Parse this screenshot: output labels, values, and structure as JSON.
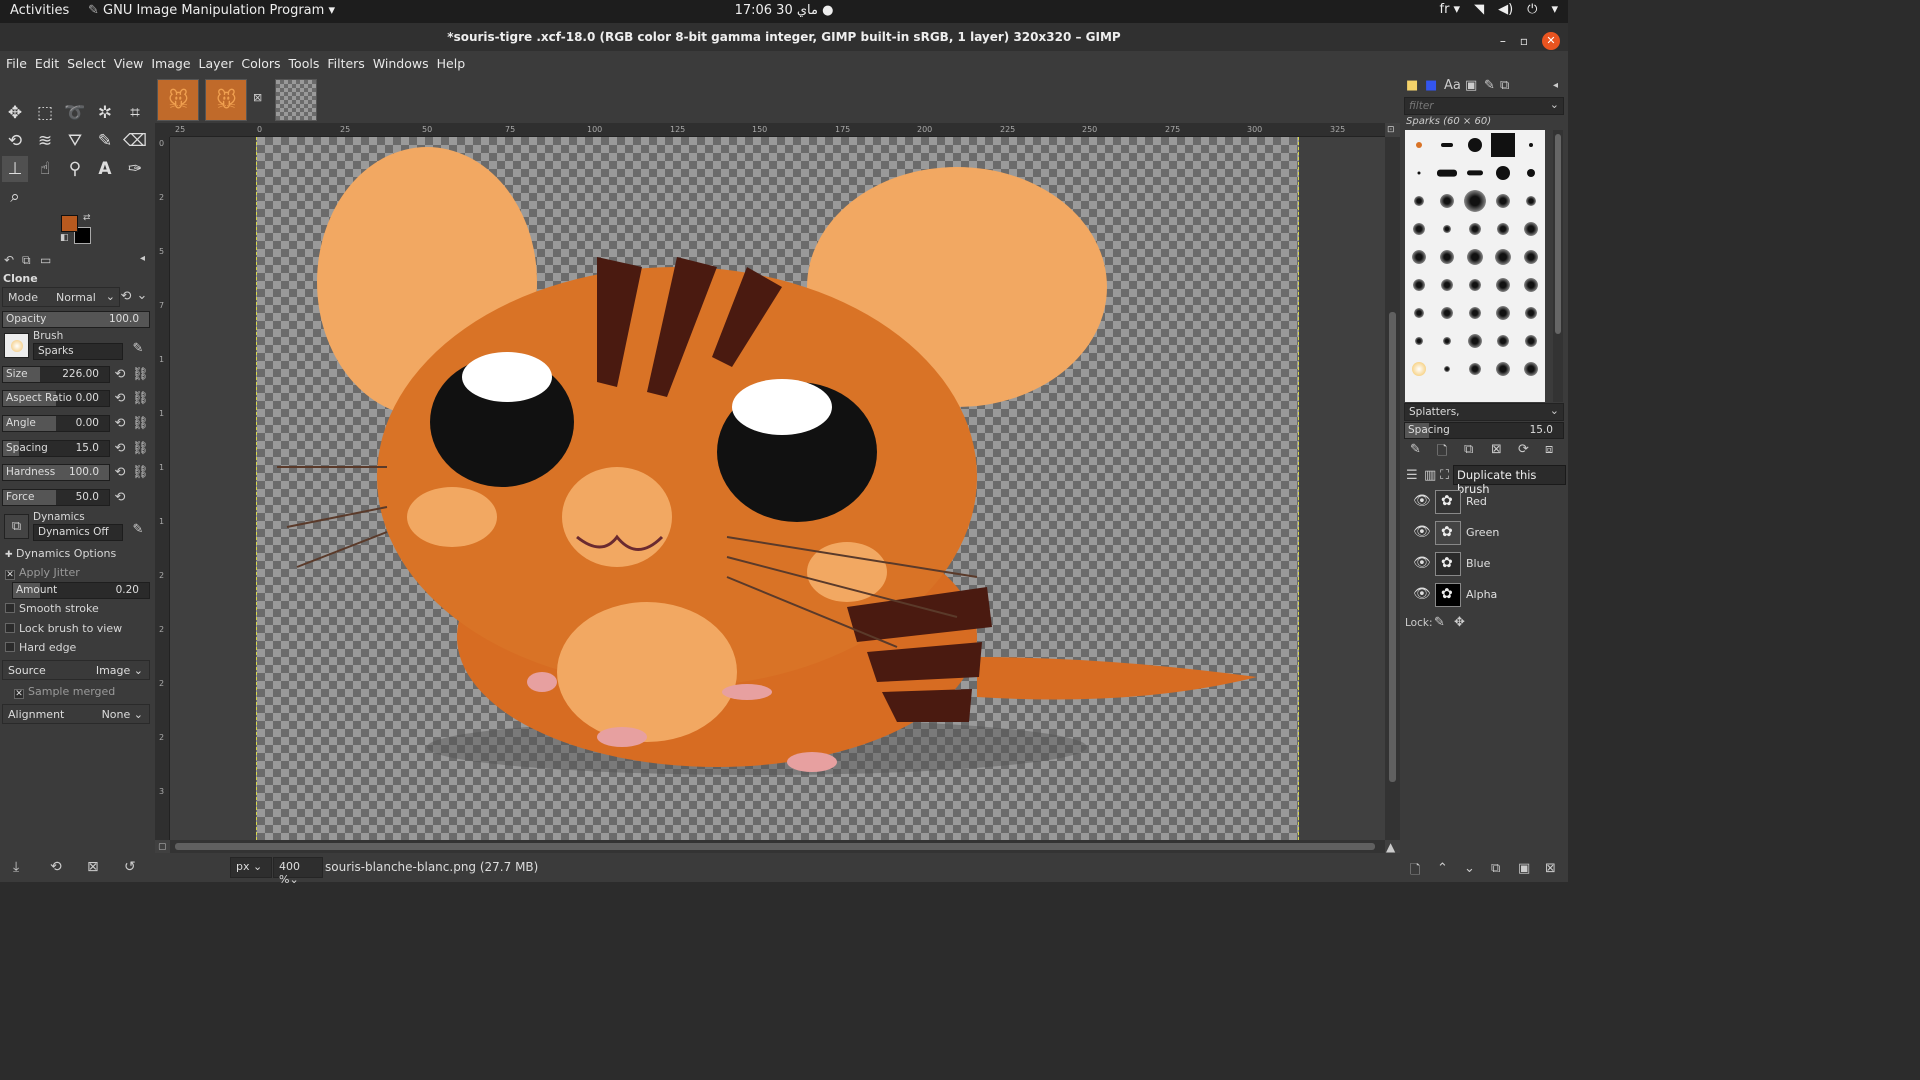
{
  "topbar": {
    "activities": "Activities",
    "app_menu": "GNU Image Manipulation Program ▾",
    "clock": "17:06  ماي 30",
    "lang": "fr ▾"
  },
  "window": {
    "title": "*souris-tigre .xcf-18.0 (RGB color 8-bit gamma integer, GIMP built-in sRGB, 1 layer) 320x320 – GIMP"
  },
  "menu": [
    "File",
    "Edit",
    "Select",
    "View",
    "Image",
    "Layer",
    "Colors",
    "Tools",
    "Filters",
    "Windows",
    "Help"
  ],
  "tool_options": {
    "title": "Clone",
    "mode_label": "Mode",
    "mode_value": "Normal",
    "opacity_label": "Opacity",
    "opacity_value": "100.0",
    "opacity_level": 1.0,
    "brush_label": "Brush",
    "brush_value": "Sparks",
    "size_label": "Size",
    "size_value": "226.00",
    "aspect_label": "Aspect Ratio",
    "aspect_value": "0.00",
    "angle_label": "Angle",
    "angle_value": "0.00",
    "spacing_label": "Spacing",
    "spacing_value": "15.0",
    "hardness_label": "Hardness",
    "hardness_value": "100.0",
    "force_label": "Force",
    "force_value": "50.0",
    "dynamics_label": "Dynamics",
    "dynamics_value": "Dynamics Off",
    "dynamics_options": "Dynamics Options",
    "apply_jitter": "Apply Jitter",
    "amount_label": "Amount",
    "amount_value": "0.20",
    "smooth_stroke": "Smooth stroke",
    "lock_brush": "Lock brush to view",
    "hard_edge": "Hard edge",
    "source_label": "Source",
    "source_value": "Image",
    "sample_merged": "Sample merged",
    "alignment_label": "Alignment",
    "alignment_value": "None"
  },
  "ruler": {
    "h_ticks": [
      "25",
      "0",
      "25",
      "50",
      "75",
      "100",
      "125",
      "150",
      "175",
      "200",
      "225",
      "250",
      "275",
      "300",
      "325"
    ],
    "v_ticks": [
      "0",
      "2",
      "5",
      "7",
      "1",
      "1",
      "1",
      "1",
      "2",
      "2",
      "2",
      "2",
      "3"
    ]
  },
  "status": {
    "unit": "px",
    "zoom": "400 %",
    "file": "souris-blanche-blanc.png (27.7 MB)"
  },
  "brushes": {
    "filter_placeholder": "filter",
    "current": "Sparks (60 × 60)",
    "tag": "Splatters,",
    "spacing_label": "Spacing",
    "spacing_value": "15.0"
  },
  "channels": {
    "tooltip": "Duplicate this brush",
    "items": [
      "Red",
      "Green",
      "Blue",
      "Alpha"
    ],
    "lock_label": "Lock:"
  },
  "colors": {
    "fg": "#b85a1f",
    "bg": "#000000",
    "accent": "#e95420"
  }
}
